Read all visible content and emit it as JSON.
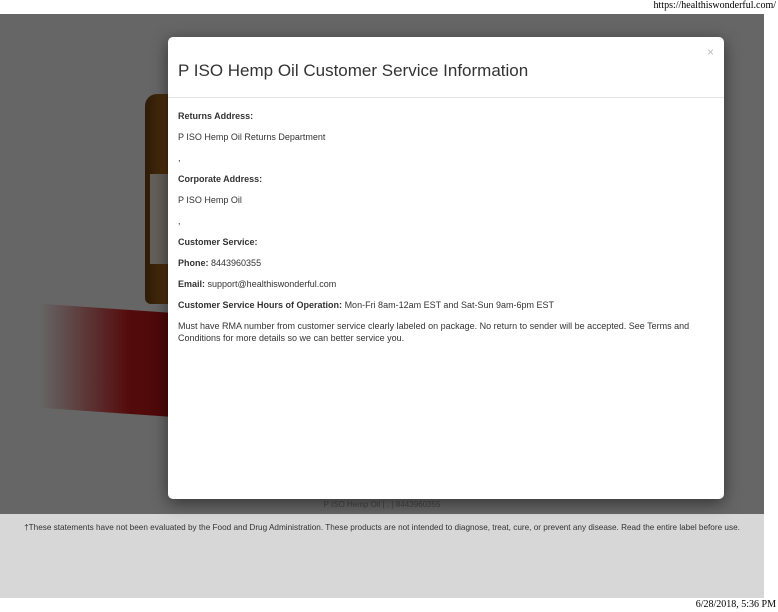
{
  "print": {
    "url": "https://healthiswonderful.com/",
    "date": "6/28/2018, 5:36 PM"
  },
  "modal": {
    "title": "P ISO Hemp Oil Customer Service Information",
    "close": "×",
    "returns_label": "Returns Address:",
    "returns_name": "P ISO Hemp Oil Returns Department",
    "returns_sep": ",",
    "corporate_label": "Corporate Address:",
    "corporate_name": "P ISO Hemp Oil",
    "corporate_sep": ",",
    "customer_service_label": "Customer Service:",
    "phone_label": "Phone:",
    "phone_value": "8443960355",
    "email_label": "Email:",
    "email_value": "support@healthiswonderful.com",
    "hours_label": "Customer Service Hours of Operation:",
    "hours_value": "Mon-Fri 8am-12am EST and Sat-Sun 9am-6pm EST",
    "notice": "Must have RMA number from customer service clearly labeled on package. No return to sender will be accepted. See Terms and Conditions for more details so we can better service you."
  },
  "footer": {
    "company_line": "P ISO Hemp Oil [ , ] 8443960355",
    "disclaimer": "†These statements have not been evaluated by the Food and Drug Administration. These products are not intended to diagnose, treat, cure, or prevent any disease. Read the entire label before use."
  }
}
